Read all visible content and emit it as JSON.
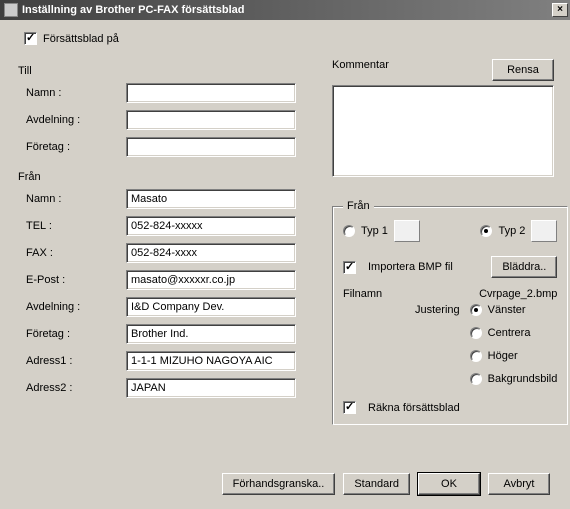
{
  "window": {
    "title": "Inställning av Brother PC-FAX försättsblad",
    "close_label": "×"
  },
  "cover_on": {
    "label": "Försättsblad på",
    "checked": true
  },
  "till": {
    "section": "Till",
    "namn_label": "Namn :",
    "namn_value": "",
    "avdelning_label": "Avdelning :",
    "avdelning_value": "",
    "foretag_label": "Företag :",
    "foretag_value": ""
  },
  "fran": {
    "section": "Från",
    "namn_label": "Namn :",
    "namn_value": "Masato",
    "tel_label": "TEL :",
    "tel_value": "052-824-xxxxx",
    "fax_label": "FAX :",
    "fax_value": "052-824-xxxx",
    "epost_label": "E-Post :",
    "epost_value": "masato@xxxxxr.co.jp",
    "avdelning_label": "Avdelning :",
    "avdelning_value": "I&D Company Dev.",
    "foretag_label": "Företag :",
    "foretag_value": "Brother Ind.",
    "adress1_label": "Adress1 :",
    "adress1_value": "1-1-1 MIZUHO NAGOYA AIC",
    "adress2_label": "Adress2 :",
    "adress2_value": "JAPAN"
  },
  "kommentar": {
    "label": "Kommentar",
    "rensa_label": "Rensa",
    "value": ""
  },
  "layout": {
    "legend": "Från",
    "typ1_label": "Typ 1",
    "typ2_label": "Typ 2",
    "selected_type": "typ2",
    "import_label": "Importera BMP fil",
    "import_checked": true,
    "bladdra_label": "Bläddra..",
    "filnamn_label": "Filnamn",
    "filnamn_value": "Cvrpage_2.bmp",
    "justering_label": "Justering",
    "just_vanster": "Vänster",
    "just_centrera": "Centrera",
    "just_hoger": "Höger",
    "just_bakgrund": "Bakgrundsbild",
    "just_selected": "vanster",
    "rakna_label": "Räkna försättsblad",
    "rakna_checked": true
  },
  "buttons": {
    "forhandsgranska": "Förhandsgranska..",
    "standard": "Standard",
    "ok": "OK",
    "avbryt": "Avbryt"
  }
}
